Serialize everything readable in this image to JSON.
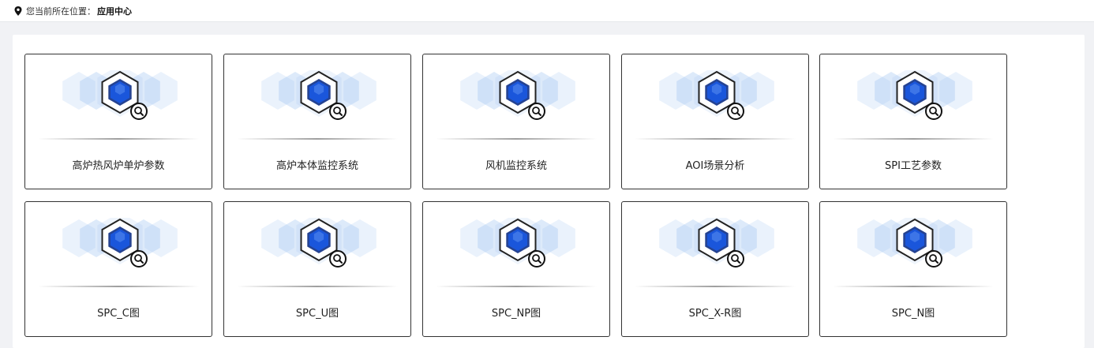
{
  "breadcrumb": {
    "prefix": "您当前所在位置：",
    "current": "应用中心"
  },
  "colors": {
    "hex_fill": "#1a56db",
    "hex_light": "#9fc4f1",
    "border": "#333333"
  },
  "apps": [
    {
      "label": "高炉热风炉单炉参数"
    },
    {
      "label": "高炉本体监控系统"
    },
    {
      "label": "风机监控系统"
    },
    {
      "label": "AOI场景分析"
    },
    {
      "label": "SPI工艺参数"
    },
    {
      "label": "SPC_C图"
    },
    {
      "label": "SPC_U图"
    },
    {
      "label": "SPC_NP图"
    },
    {
      "label": "SPC_X-R图"
    },
    {
      "label": "SPC_N图"
    }
  ]
}
